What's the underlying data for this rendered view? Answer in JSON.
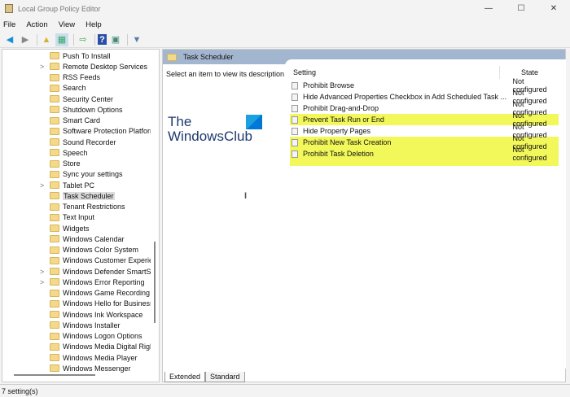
{
  "window": {
    "title": "Local Group Policy Editor",
    "minimize": "—",
    "maximize": "☐",
    "close": "✕"
  },
  "menu": [
    "File",
    "Action",
    "View",
    "Help"
  ],
  "toolbar": {
    "back": "back-arrow",
    "forward": "forward-arrow",
    "up": "up-folder",
    "show_hide": "show-hide-tree",
    "export": "export-list",
    "help": "help",
    "properties": "properties",
    "filter": "filter"
  },
  "tree": [
    {
      "label": "Push To Install"
    },
    {
      "label": "Remote Desktop Services",
      "expand": true
    },
    {
      "label": "RSS Feeds"
    },
    {
      "label": "Search"
    },
    {
      "label": "Security Center"
    },
    {
      "label": "Shutdown Options"
    },
    {
      "label": "Smart Card"
    },
    {
      "label": "Software Protection Platform"
    },
    {
      "label": "Sound Recorder"
    },
    {
      "label": "Speech"
    },
    {
      "label": "Store"
    },
    {
      "label": "Sync your settings"
    },
    {
      "label": "Tablet PC",
      "expand": true
    },
    {
      "label": "Task Scheduler",
      "selected": true
    },
    {
      "label": "Tenant Restrictions"
    },
    {
      "label": "Text Input"
    },
    {
      "label": "Widgets"
    },
    {
      "label": "Windows Calendar"
    },
    {
      "label": "Windows Color System"
    },
    {
      "label": "Windows Customer Experience"
    },
    {
      "label": "Windows Defender SmartScreen",
      "expand": true
    },
    {
      "label": "Windows Error Reporting",
      "expand": true
    },
    {
      "label": "Windows Game Recording and Broadcasting"
    },
    {
      "label": "Windows Hello for Business"
    },
    {
      "label": "Windows Ink Workspace"
    },
    {
      "label": "Windows Installer"
    },
    {
      "label": "Windows Logon Options"
    },
    {
      "label": "Windows Media Digital Rights Management"
    },
    {
      "label": "Windows Media Player"
    },
    {
      "label": "Windows Messenger"
    }
  ],
  "right": {
    "header": "Task Scheduler",
    "description": "Select an item to view its description.",
    "watermark": "The WindowsClub",
    "columns": {
      "setting": "Setting",
      "state": "State"
    },
    "settings": [
      {
        "name": "Prohibit Browse",
        "state": "Not configured",
        "highlight": false
      },
      {
        "name": "Hide Advanced Properties Checkbox in Add Scheduled Task ...",
        "state": "Not configured",
        "highlight": false
      },
      {
        "name": "Prohibit Drag-and-Drop",
        "state": "Not configured",
        "highlight": false
      },
      {
        "name": "Prevent Task Run or End",
        "state": "Not configured",
        "highlight": true
      },
      {
        "name": "Hide Property Pages",
        "state": "Not configured",
        "highlight": false
      },
      {
        "name": "Prohibit New Task Creation",
        "state": "Not configured",
        "highlight": true
      },
      {
        "name": "Prohibit Task Deletion",
        "state": "Not configured",
        "highlight": true
      }
    ],
    "tabs": [
      "Extended",
      "Standard"
    ]
  },
  "status": "7 setting(s)",
  "colors": {
    "highlight": "#f2f75a",
    "header": "#a3b6cf"
  }
}
